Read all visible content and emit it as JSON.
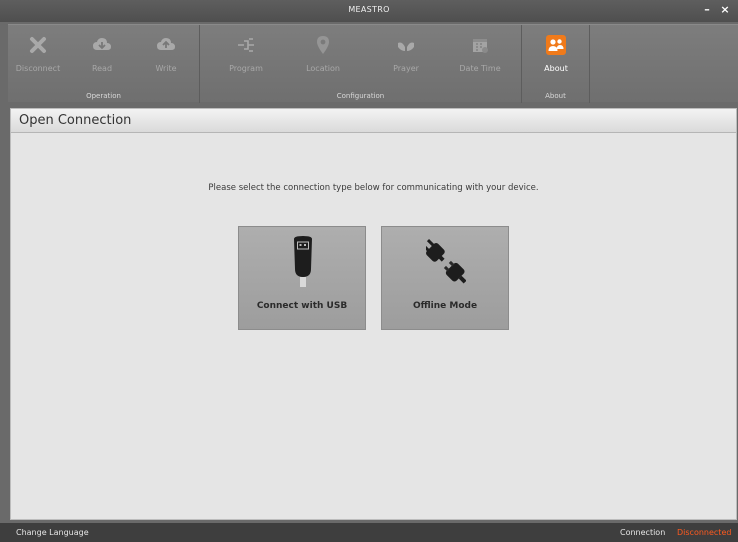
{
  "window": {
    "title": "MEASTRO",
    "minimize_glyph": "–",
    "close_glyph": "×"
  },
  "ribbon": {
    "groups": [
      {
        "label": "Operation",
        "buttons": [
          {
            "label": "Disconnect",
            "icon": "close-x-icon"
          },
          {
            "label": "Read",
            "icon": "cloud-download-icon"
          },
          {
            "label": "Write",
            "icon": "cloud-upload-icon"
          }
        ]
      },
      {
        "label": "Configuration",
        "buttons": [
          {
            "label": "Program",
            "icon": "program-icon"
          },
          {
            "label": "Location",
            "icon": "location-pin-icon"
          },
          {
            "label": "Prayer",
            "icon": "prayer-hands-icon"
          },
          {
            "label": "Date Time",
            "icon": "calendar-icon"
          }
        ]
      },
      {
        "label": "About",
        "buttons": [
          {
            "label": "About",
            "icon": "users-icon"
          }
        ]
      }
    ],
    "active_color": "#f07a1a"
  },
  "panel": {
    "title": "Open Connection",
    "prompt": "Please select the connection type below for communicating with your device.",
    "options": [
      {
        "label": "Connect with USB",
        "icon": "usb-stick-icon"
      },
      {
        "label": "Offline Mode",
        "icon": "unplugged-icon"
      }
    ]
  },
  "status": {
    "language": "Change Language",
    "connection_label": "Connection",
    "connection_state": "Disconnected",
    "state_color": "#ff5a1f"
  }
}
